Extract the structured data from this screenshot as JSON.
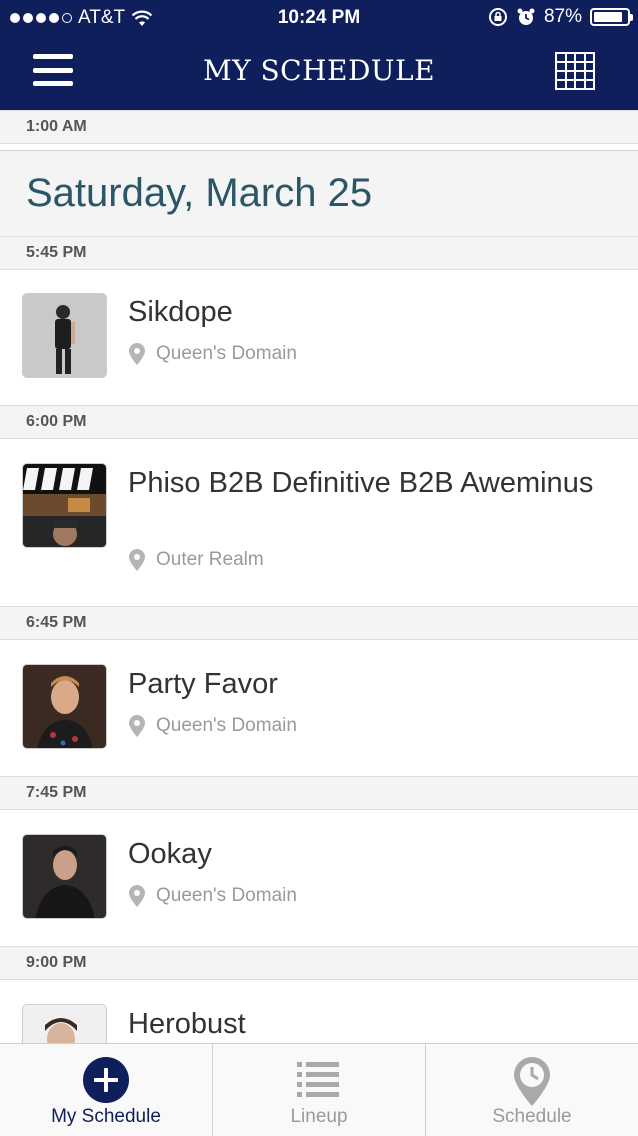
{
  "status_bar": {
    "carrier": "AT&T",
    "time": "10:24 PM",
    "battery": "87%",
    "battery_level": 0.87,
    "signal_icon": "signal-dots-icon",
    "wifi_icon": "wifi-icon",
    "lock_icon": "rotation-lock-icon",
    "alarm_icon": "alarm-icon"
  },
  "header": {
    "title": "MY SCHEDULE",
    "menu_icon": "hamburger-menu-icon",
    "grid_icon": "grid-view-icon",
    "background": "#0e1f5c"
  },
  "schedule": {
    "top_time": "1:00 AM",
    "date_heading": "Saturday, March 25",
    "slots": [
      {
        "time": "5:45 PM",
        "artist": "Sikdope",
        "venue": "Queen's Domain"
      },
      {
        "time": "6:00 PM",
        "artist": "Phiso B2B Definitive B2B Aweminus",
        "venue": "Outer Realm"
      },
      {
        "time": "6:45 PM",
        "artist": "Party Favor",
        "venue": "Queen's Domain"
      },
      {
        "time": "7:45 PM",
        "artist": "Ookay",
        "venue": "Queen's Domain"
      },
      {
        "time": "9:00 PM",
        "artist": "Herobust",
        "venue": ""
      }
    ]
  },
  "tabbar": {
    "tabs": [
      {
        "label": "My Schedule",
        "icon": "add-circle-icon",
        "active": true
      },
      {
        "label": "Lineup",
        "icon": "list-icon",
        "active": false
      },
      {
        "label": "Schedule",
        "icon": "clock-pin-icon",
        "active": false
      }
    ]
  },
  "colors": {
    "accent": "#0e1f5c",
    "date_text": "#2a5667",
    "muted": "#9a9a9a"
  }
}
